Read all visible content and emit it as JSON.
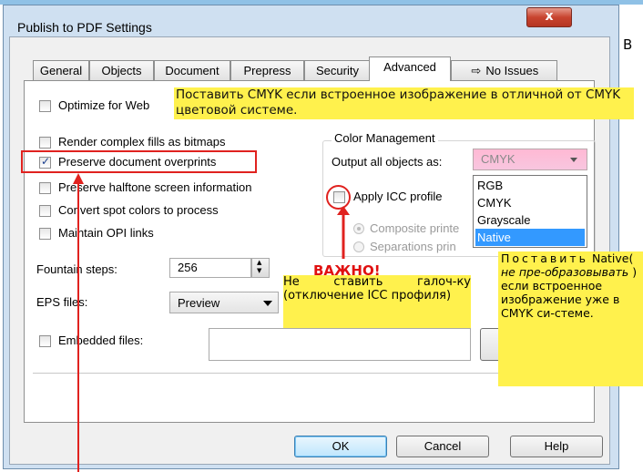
{
  "dialog": {
    "title": "Publish to PDF Settings",
    "close_label": "x"
  },
  "tabs": [
    {
      "label": "General"
    },
    {
      "label": "Objects"
    },
    {
      "label": "Document"
    },
    {
      "label": "Prepress"
    },
    {
      "label": "Security"
    },
    {
      "label": "Advanced",
      "active": true
    },
    {
      "label": "No Issues",
      "icon": "issues-icon"
    }
  ],
  "options": {
    "optimize_web": "Optimize for Web",
    "render_complex": "Render complex fills as bitmaps",
    "preserve_overprints": "Preserve document overprints",
    "preserve_halftone": "Preserve halftone screen information",
    "convert_spot": "Convert spot colors to process",
    "maintain_opi": "Maintain OPI links"
  },
  "fountain_steps": {
    "label": "Fountain steps:",
    "value": "256"
  },
  "eps_files": {
    "label": "EPS files:",
    "value": "Preview"
  },
  "embedded_files": {
    "label": "Embedded files:"
  },
  "color_management": {
    "group_title": "Color Management",
    "output_label": "Output all objects as:",
    "selected": "CMYK",
    "options": [
      "RGB",
      "CMYK",
      "Grayscale",
      "Native"
    ],
    "highlighted_option": "Native",
    "apply_icc": "Apply ICC profile",
    "composite": "Composite printe",
    "separations": "Separations prin"
  },
  "buttons": {
    "ok": "OK",
    "cancel": "Cancel",
    "help": "Help"
  },
  "annotations": {
    "note_top": "Поставить CMYK если встроенное изображение в отличной от CMYK цветовой системе.",
    "important": "ВАЖНО!",
    "note_mid": "Не ставить галоч-ку (отключение ICC профиля)",
    "note_right_1": "Поставить",
    "note_right_2": "Native(",
    "note_right_3": "не пре-образовывать",
    "note_right_4": ") если встроенное изображение уже в CMYK си-стеме.",
    "outside_letter": "В"
  },
  "colors": {
    "annotation_yellow": "#fff14d",
    "annotation_red": "#e0221f",
    "selection_blue": "#3399ff"
  }
}
